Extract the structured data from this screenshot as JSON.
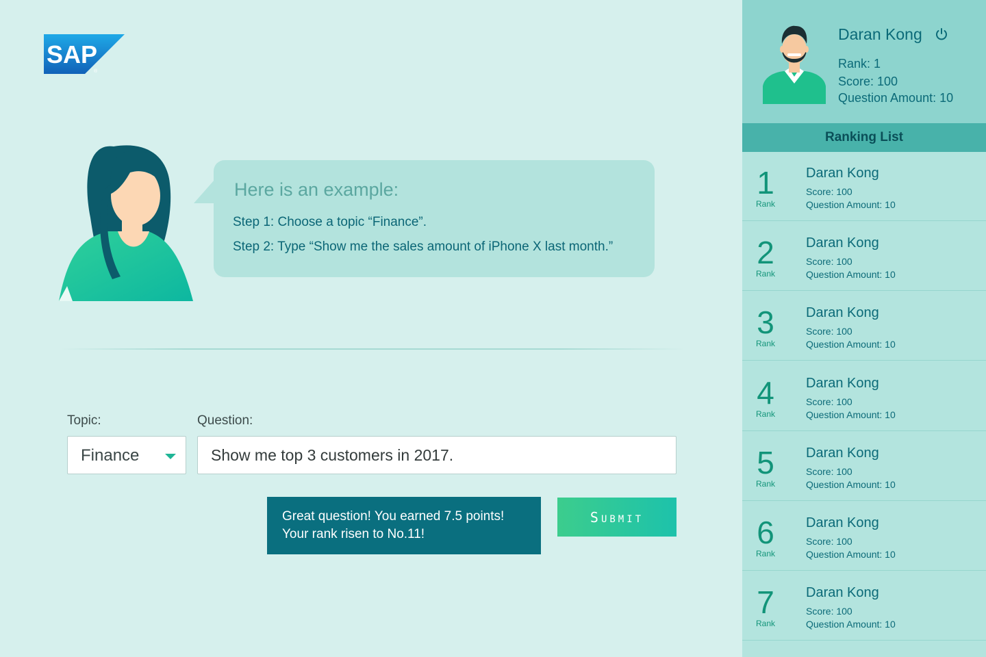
{
  "brand": {
    "logo_text": "SAP"
  },
  "assistant": {
    "bubble_title": "Here is an example:",
    "step1": "Step 1: Choose a topic “Finance”.",
    "step2": "Step 2: Type “Show me the sales amount of iPhone X last month.”"
  },
  "form": {
    "topic_label": "Topic:",
    "topic_value": "Finance",
    "question_label": "Question:",
    "question_value": "Show me top 3 customers in 2017.",
    "submit_label": "Submit"
  },
  "toast": {
    "line1": "Great question!  You earned 7.5 points!",
    "line2": "Your rank risen to No.11!"
  },
  "profile": {
    "name": "Daran Kong",
    "rank": "Rank: 1",
    "score": "Score: 100",
    "amount": "Question Amount: 10"
  },
  "ranking": {
    "title": "Ranking List",
    "caption": "Rank",
    "entries": [
      {
        "rank": "1",
        "name": "Daran Kong",
        "score": "Score: 100",
        "amount": "Question Amount: 10"
      },
      {
        "rank": "2",
        "name": "Daran Kong",
        "score": "Score: 100",
        "amount": "Question Amount: 10"
      },
      {
        "rank": "3",
        "name": "Daran Kong",
        "score": "Score: 100",
        "amount": "Question Amount: 10"
      },
      {
        "rank": "4",
        "name": "Daran Kong",
        "score": "Score: 100",
        "amount": "Question Amount: 10"
      },
      {
        "rank": "5",
        "name": "Daran Kong",
        "score": "Score: 100",
        "amount": "Question Amount: 10"
      },
      {
        "rank": "6",
        "name": "Daran Kong",
        "score": "Score: 100",
        "amount": "Question Amount: 10"
      },
      {
        "rank": "7",
        "name": "Daran Kong",
        "score": "Score: 100",
        "amount": "Question Amount: 10"
      }
    ]
  },
  "colors": {
    "background": "#d6f0ed",
    "sidebar": "#b3e4de",
    "profile_panel": "#8dd4ce",
    "ranking_header": "#48b2aa",
    "accent_teal": "#0a6f7f",
    "accent_green": "#1fb596"
  },
  "icons": {
    "logo": "sap-logo",
    "power": "power-icon",
    "dropdown": "chevron-down-icon",
    "assistant": "assistant-avatar",
    "user": "user-avatar"
  }
}
